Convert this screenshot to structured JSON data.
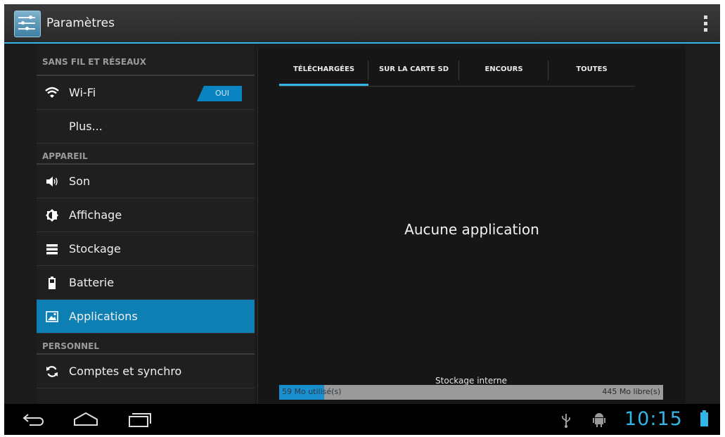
{
  "action_bar": {
    "title": "Paramètres"
  },
  "sidebar": {
    "sections": {
      "wireless": "SANS FIL ET RÉSEAUX",
      "device": "APPAREIL",
      "personal": "PERSONNEL"
    },
    "items": {
      "wifi": {
        "label": "Wi-Fi",
        "toggle": "OUI"
      },
      "more": {
        "label": "Plus..."
      },
      "sound": {
        "label": "Son"
      },
      "display": {
        "label": "Affichage"
      },
      "storage": {
        "label": "Stockage"
      },
      "battery": {
        "label": "Batterie"
      },
      "apps": {
        "label": "Applications",
        "selected": true
      },
      "accounts": {
        "label": "Comptes et synchro"
      }
    }
  },
  "tabs": [
    "TÉLÉCHARGÉES",
    "SUR LA CARTE SD",
    "ENCOURS",
    "TOUTES"
  ],
  "active_tab": 0,
  "content": {
    "empty_message": "Aucune application",
    "storage": {
      "title": "Stockage interne",
      "used_label": "59 Mo utilisé(s)",
      "free_label": "445 Mo libre(s)",
      "used_mb": 59,
      "free_mb": 445
    }
  },
  "status_bar": {
    "clock": "10:15"
  },
  "colors": {
    "accent": "#33b5e5",
    "selected": "#0e7fb3",
    "background": "#1b1b1b"
  }
}
